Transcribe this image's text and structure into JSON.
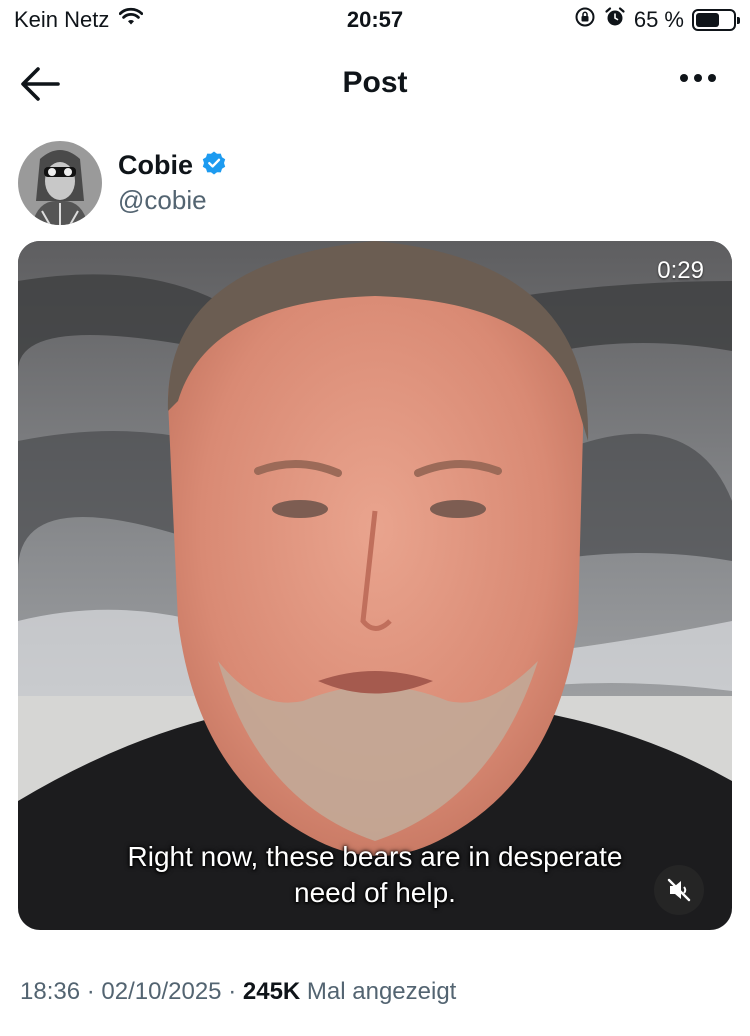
{
  "status_bar": {
    "carrier": "Kein Netz",
    "time": "20:57",
    "battery_text": "65 %",
    "battery_level": 0.65,
    "icons": [
      "wifi-icon",
      "rotation-lock-icon",
      "alarm-icon",
      "battery-icon"
    ]
  },
  "header": {
    "title": "Post",
    "back_icon": "arrow-left-icon",
    "more_icon": "more-horizontal-icon"
  },
  "author": {
    "name": "Cobie",
    "handle": "@cobie",
    "verified": true,
    "verified_color": "#1d9bf0"
  },
  "media": {
    "duration": "0:29",
    "subtitle_line1": "Right now, these bears are in desperate",
    "subtitle_line2": "need of help.",
    "mute_icon": "speaker-muted-icon"
  },
  "meta": {
    "time": "18:36",
    "separator": "·",
    "date": "02/10/2025",
    "views_count": "245K",
    "views_label": "Mal angezeigt"
  },
  "colors": {
    "text": "#0f1419",
    "secondary": "#536471",
    "accent": "#1d9bf0"
  }
}
